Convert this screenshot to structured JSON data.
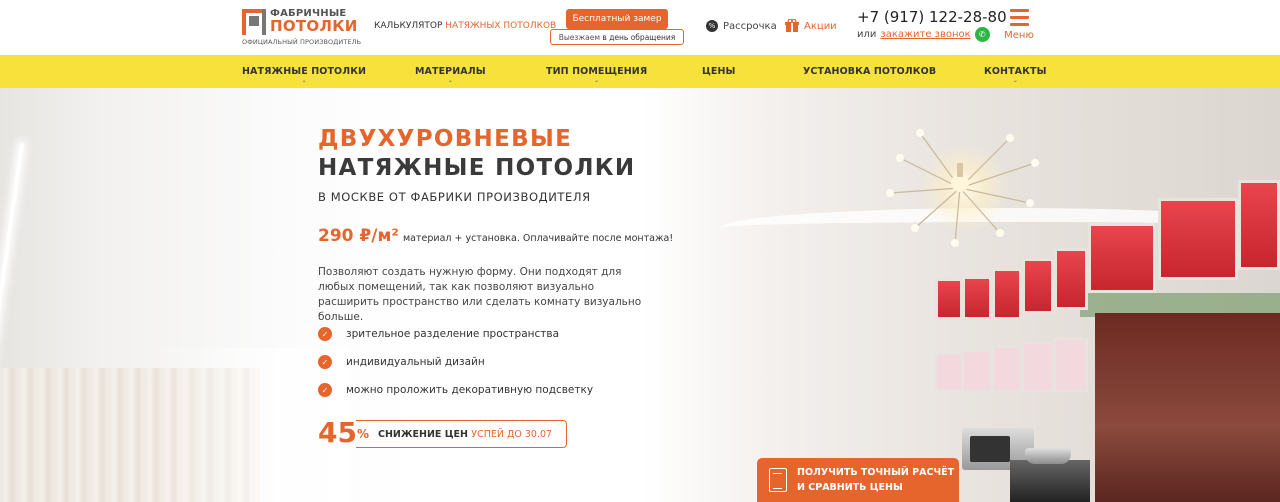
{
  "brand": {
    "name_line1": "ФАБРИЧНЫЕ",
    "name_line2": "ПОТОЛКИ",
    "tagline": "ОФИЦИАЛЬНЫЙ ПРОИЗВОДИТЕЛЬ",
    "accent_color": "#e5652d",
    "nav_color": "#f7e23b"
  },
  "header": {
    "calc_prefix": "КАЛЬКУЛЯТОР",
    "calc_accent": "НАТЯЖНЫХ ПОТОЛКОВ",
    "free_measure": "Бесплатный замер",
    "free_sub_prefix": "Выезжаем",
    "free_sub_bold": "в день обращения",
    "installment": "Рассрочка",
    "promo": "Акции",
    "phone": "+7 (917) 122-28-80",
    "or": "или",
    "callback": "закажите звонок",
    "menu": "Меню"
  },
  "nav": {
    "items": [
      {
        "label": "НАТЯЖНЫЕ ПОТОЛКИ"
      },
      {
        "label": "МАТЕРИАЛЫ"
      },
      {
        "label": "ТИП ПОМЕЩЕНИЯ"
      },
      {
        "label": "ЦЕНЫ"
      },
      {
        "label": "УСТАНОВКА ПОТОЛКОВ"
      },
      {
        "label": "КОНТАКТЫ"
      }
    ]
  },
  "hero": {
    "title_accent": "ДВУХУРОВНЕВЫЕ",
    "title_main": "НАТЯЖНЫЕ ПОТОЛКИ",
    "subtitle": "В МОСКВЕ ОТ ФАБРИКИ ПРОИЗВОДИТЕЛЯ",
    "price": "290 ₽/м²",
    "price_note": "материал + установка. Оплачивайте после монтажа!",
    "description": "Позволяют создать нужную форму. Они подходят для любых помещений, так как позволяют визуально расширить пространство или сделать комнату визуально больше.",
    "features": [
      "зрительное разделение пространства",
      "индивидуальный дизайн",
      "можно проложить декоративную подсветку"
    ],
    "discount_value": "45",
    "discount_pct": "%",
    "discount_label": "СНИЖЕНИЕ ЦЕН",
    "discount_deadline": "УСПЕЙ ДО 30.07",
    "cta_line1": "ПОЛУЧИТЬ ТОЧНЫЙ РАСЧЁТ",
    "cta_line2": "И СРАВНИТЬ ЦЕНЫ"
  }
}
